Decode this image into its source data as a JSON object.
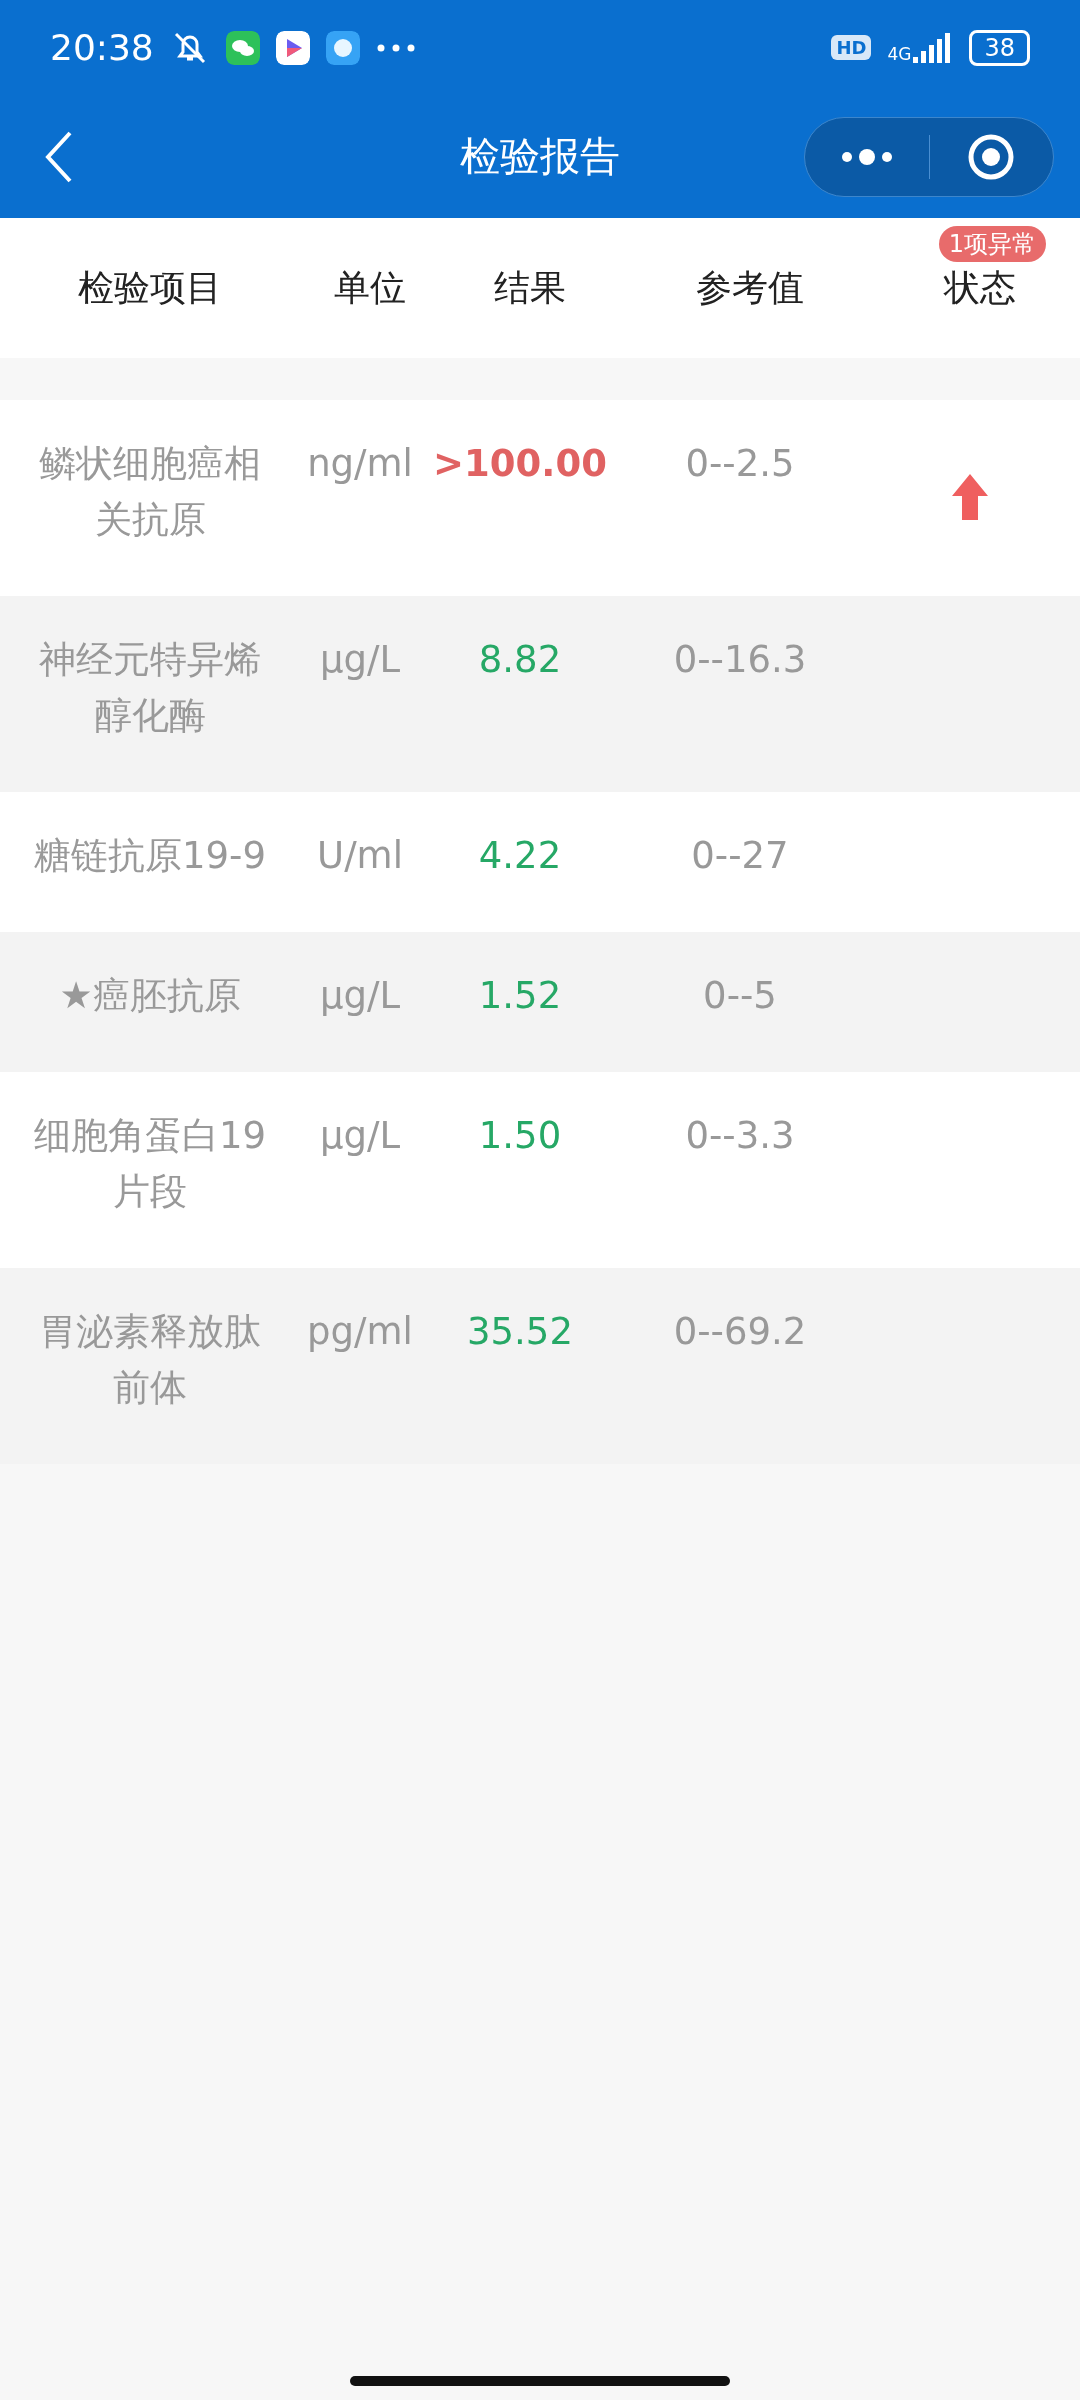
{
  "status_bar": {
    "time": "20:38",
    "network": "4G",
    "hd": "HD",
    "battery": "38"
  },
  "header": {
    "title": "检验报告"
  },
  "columns": [
    {
      "label": "检验项目"
    },
    {
      "label": "单位"
    },
    {
      "label": "结果"
    },
    {
      "label": "参考值"
    },
    {
      "label": "状态",
      "badge": "1项异常"
    }
  ],
  "rows": [
    {
      "name": "鳞状细胞癌相关抗原",
      "unit": "ng/ml",
      "result": ">100.00",
      "reference": "0--2.5",
      "abnormal": true
    },
    {
      "name": "神经元特异烯醇化酶",
      "unit": "μg/L",
      "result": "8.82",
      "reference": "0--16.3",
      "abnormal": false
    },
    {
      "name": "糖链抗原19-9",
      "unit": "U/ml",
      "result": "4.22",
      "reference": "0--27",
      "abnormal": false
    },
    {
      "name": "★癌胚抗原",
      "unit": "μg/L",
      "result": "1.52",
      "reference": "0--5",
      "abnormal": false
    },
    {
      "name": "细胞角蛋白19片段",
      "unit": "μg/L",
      "result": "1.50",
      "reference": "0--3.3",
      "abnormal": false
    },
    {
      "name": "胃泌素释放肽前体",
      "unit": "pg/ml",
      "result": "35.52",
      "reference": "0--69.2",
      "abnormal": false
    }
  ]
}
